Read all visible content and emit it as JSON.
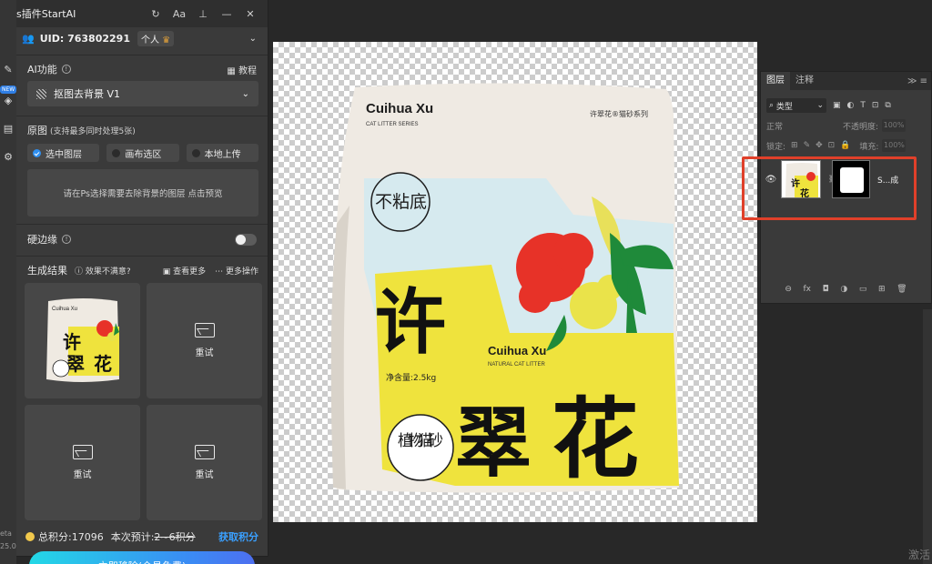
{
  "plugin": {
    "title": "s插件StartAI",
    "uid_label": "UID: 763802291",
    "account_badge": "个人",
    "ai_feature": {
      "label": "AI功能",
      "tutorial": "教程",
      "selected": "抠图去背景 V1"
    },
    "source": {
      "label": "原图",
      "hint": "(支持最多同时处理5张)",
      "options": [
        "选中图层",
        "画布选区",
        "本地上传"
      ],
      "selected_index": 0,
      "preview_text": "请在Ps选择需要去除背景的图层 点击预览"
    },
    "hard_edge": {
      "label": "硬边缘",
      "enabled": false
    },
    "results": {
      "label": "生成结果",
      "not_satisfied": "效果不满意?",
      "view_more": "查看更多",
      "more_actions": "更多操作",
      "retry_label": "重试"
    },
    "points": {
      "total": "总积分:17096",
      "estimate_label": "本次预计:",
      "estimate_value": "2~6积分",
      "get_points": "获取积分"
    },
    "action_button": "立即移除(会员免费)"
  },
  "side_strip": {
    "new_badge": "NEW",
    "beta_label": "eta",
    "version": "25.0"
  },
  "layers_panel": {
    "tabs": [
      "图层",
      "注释"
    ],
    "filter_type": "类型",
    "blend_mode": "正常",
    "opacity_label": "不透明度:",
    "opacity_value": "100%",
    "lock_label": "锁定:",
    "fill_label": "填充:",
    "fill_value": "100%",
    "layer_name": "S...成"
  },
  "product": {
    "brand": "Cuihua Xu",
    "brand_sub": "CAT LITTER SERIES",
    "series": "许翠花®猫砂系列",
    "badge_text": "不粘底",
    "big_text": [
      "许",
      "翠",
      "花"
    ],
    "brand_mid": "Cuihua Xu",
    "brand_mid_sub": "NATURAL CAT LITTER",
    "net_weight": "净含量:2.5kg",
    "circle_text": "植物猫砂"
  },
  "watermark": "激活"
}
